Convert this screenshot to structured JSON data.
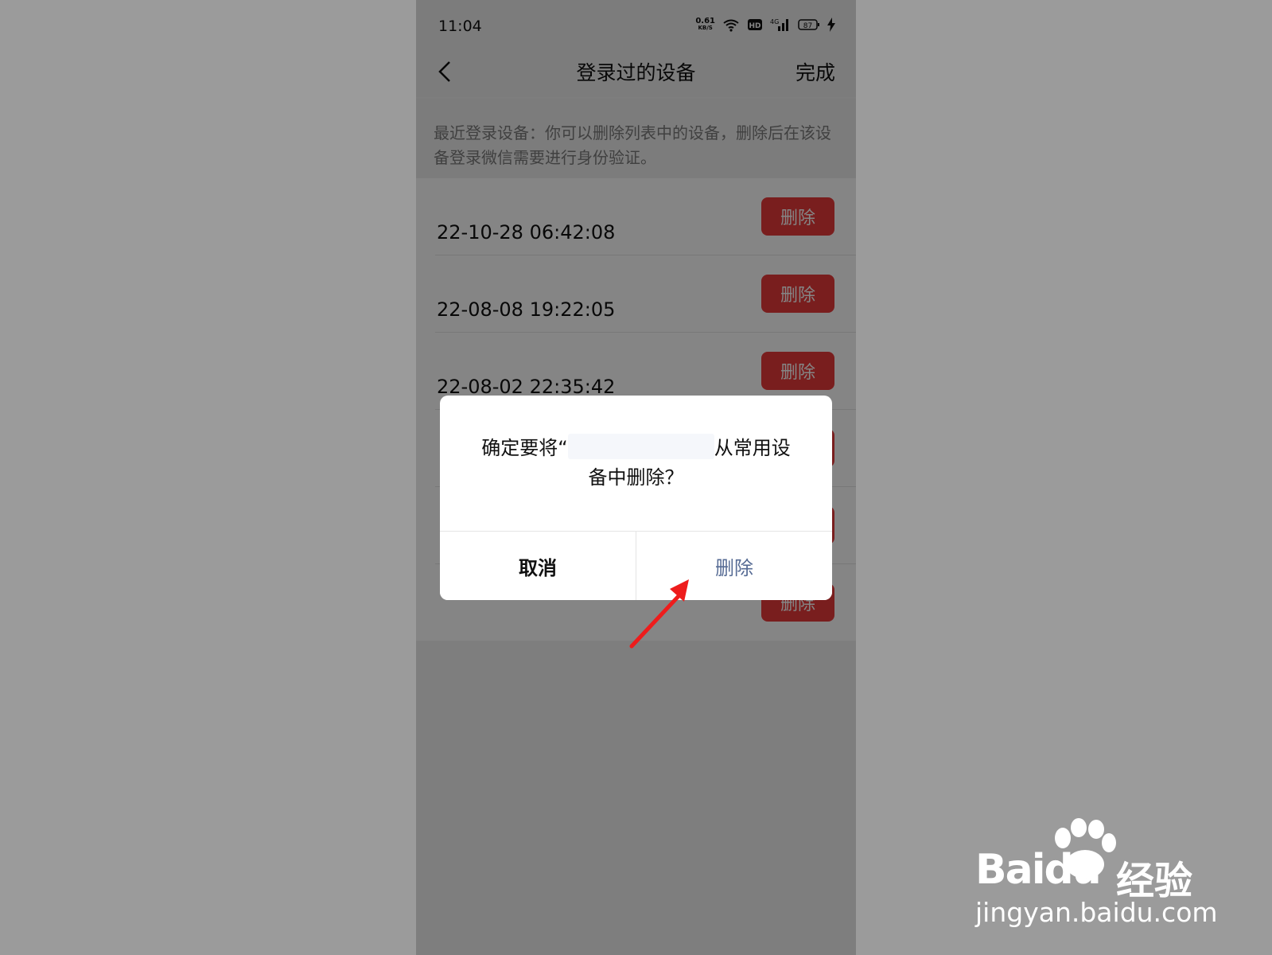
{
  "status_bar": {
    "time": "11:04",
    "net_speed": "0.61",
    "net_unit": "KB/S",
    "hd": "HD",
    "signal": "4G",
    "battery": "87"
  },
  "nav": {
    "title": "登录过的设备",
    "done": "完成"
  },
  "info": {
    "text": "最近登录设备：你可以删除列表中的设备，删除后在该设备登录微信需要进行身份验证。"
  },
  "devices": [
    {
      "time": "22-10-28 06:42:08",
      "delete_label": "删除"
    },
    {
      "time": "22-08-08 19:22:05",
      "delete_label": "删除"
    },
    {
      "time": "22-08-02 22:35:42",
      "delete_label": "删除"
    },
    {
      "time": "",
      "delete_label": "删除"
    },
    {
      "time": "",
      "delete_label": "删除"
    },
    {
      "time": "",
      "delete_label": "删除"
    }
  ],
  "dialog": {
    "message_prefix": "确定要将“",
    "message_suffix": "从常用设",
    "message_line2": "备中删除？",
    "cancel": "取消",
    "confirm": "删除"
  },
  "watermark": {
    "brand": "Baidu",
    "name": "经验",
    "url": "jingyan.baidu.com"
  },
  "colors": {
    "delete_red": "#e93b3b",
    "confirm_blue": "#566b94",
    "arrow_red": "#ee1c1c"
  }
}
